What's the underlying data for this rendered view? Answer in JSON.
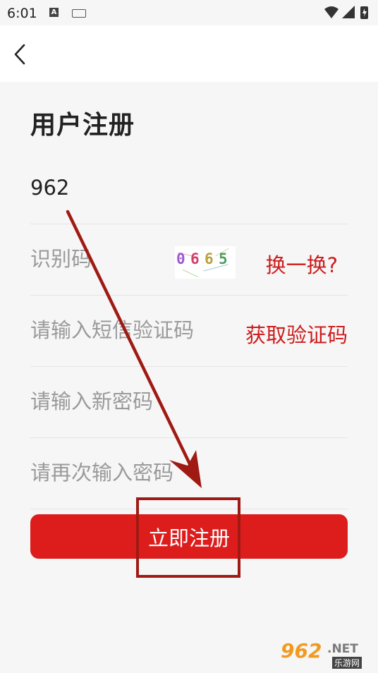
{
  "status_bar": {
    "time": "6:01",
    "a_icon_label": "A"
  },
  "header": {
    "back_icon": "chevron-left-icon"
  },
  "page": {
    "title": "用户注册"
  },
  "form": {
    "phone_value": "962",
    "captcha_placeholder": "识别码",
    "captcha_image_text": [
      "0",
      "6",
      "6",
      "5"
    ],
    "captcha_refresh_label": "换一换?",
    "sms_placeholder": "请输入短信验证码",
    "get_code_label": "获取验证码",
    "new_password_placeholder": "请输入新密码",
    "confirm_password_placeholder": "请再次输入密码",
    "submit_label": "立即注册"
  },
  "watermark": {
    "brand": "962",
    "suffix": ".NET",
    "tagline": "乐游网"
  },
  "colors": {
    "accent": "#dd1c1c",
    "link_red": "#cc1c1c",
    "annotation": "#a01a14"
  }
}
